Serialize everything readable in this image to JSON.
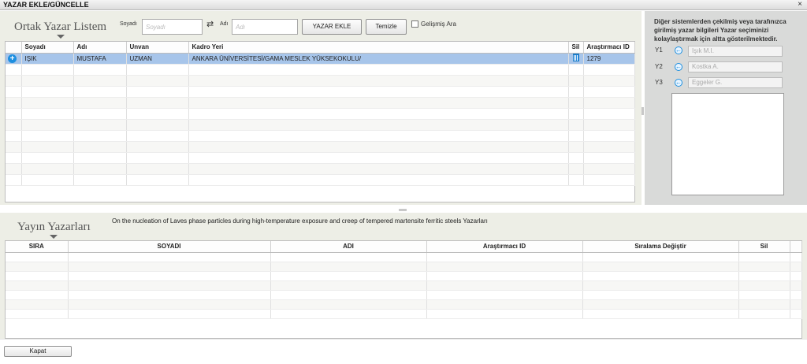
{
  "window": {
    "title": "YAZAR EKLE/GÜNCELLE",
    "close": "×"
  },
  "top": {
    "section_title": "Ortak Yazar Listem",
    "surname_label": "Soyadı",
    "surname_placeholder": "Soyadı",
    "name_label": "Adı",
    "name_placeholder": "Adı",
    "swap_icon": "swap-icon",
    "add_button": "YAZAR EKLE",
    "clear_button": "Temizle",
    "advanced_label": "Gelişmiş Ara",
    "advanced_checked": false,
    "columns": [
      "",
      "Soyadı",
      "Adı",
      "Unvan",
      "Kadro Yeri",
      "Sil",
      "Araştırmacı ID"
    ],
    "rows": [
      {
        "soyadi": "IŞIK",
        "adi": "MUSTAFA",
        "unvan": "UZMAN",
        "kadro": "ANKARA ÜNİVERSİTESİ/GAMA MESLEK YÜKSEKOKULU/",
        "arastirmaci_id": "1279"
      }
    ]
  },
  "suggest": {
    "info": "Diğer sistemlerden çekilmiş veya tarafınızca girilmiş yazar bilgileri Yazar seçiminizi kolaylaştırmak için altta gösterilmektedir.",
    "items": [
      {
        "label": "Y1",
        "value": "Işık M.I."
      },
      {
        "label": "Y2",
        "value": "Kostka A."
      },
      {
        "label": "Y3",
        "value": "Eggeler G."
      }
    ]
  },
  "bottom": {
    "section_title": "Yayın Yazarları",
    "publication": "On the nucleation of Laves phase particles during high-temperature exposure and creep of tempered martensite ferritic steels  Yazarları",
    "columns": [
      "SIRA",
      "SOYADI",
      "ADI",
      "Araştırmacı ID",
      "Sıralama Değiştir",
      "Sil"
    ]
  },
  "footer": {
    "close_button": "Kapat"
  },
  "colors": {
    "accent": "#1d8fe0",
    "selected_row": "#a7c5ea",
    "panel": "#edeee6"
  }
}
